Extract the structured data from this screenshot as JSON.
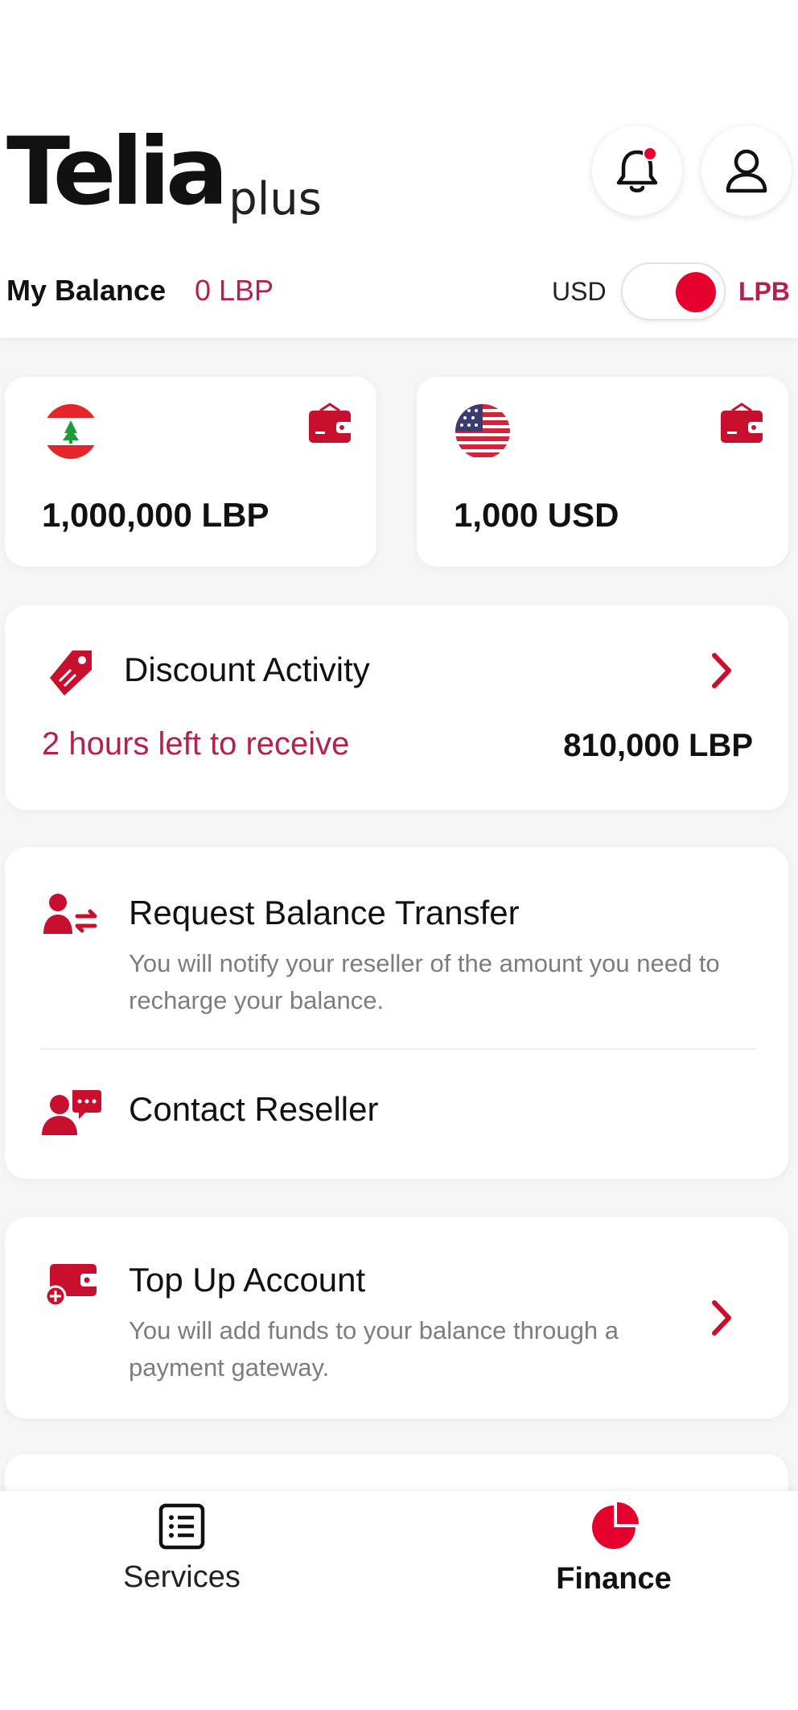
{
  "header": {
    "logo_main": "Telia",
    "logo_sub": "plus",
    "notification_icon": "bell-icon",
    "profile_icon": "user-icon"
  },
  "balance": {
    "label": "My Balance",
    "value": "0 LBP",
    "currency_left": "USD",
    "currency_right": "LPB",
    "toggle_on": true
  },
  "wallets": [
    {
      "flag": "lebanon-flag-icon",
      "amount": "1,000,000 LBP"
    },
    {
      "flag": "usa-flag-icon",
      "amount": "1,000 USD"
    }
  ],
  "discount": {
    "title": "Discount Activity",
    "subtitle": "2 hours left to receive",
    "amount": "810,000 LBP"
  },
  "request_transfer": {
    "title": "Request Balance Transfer",
    "description": "You will notify your reseller of the amount you need to recharge your balance."
  },
  "contact_reseller": {
    "title": "Contact Reseller"
  },
  "top_up": {
    "title": "Top Up Account",
    "description": "You will add funds to your balance through a payment gateway."
  },
  "bottom_nav": {
    "services_label": "Services",
    "finance_label": "Finance",
    "active": "Finance"
  },
  "colors": {
    "accent": "#e6002d",
    "accent_dark": "#c8102e",
    "pink_text": "#b3214d"
  }
}
